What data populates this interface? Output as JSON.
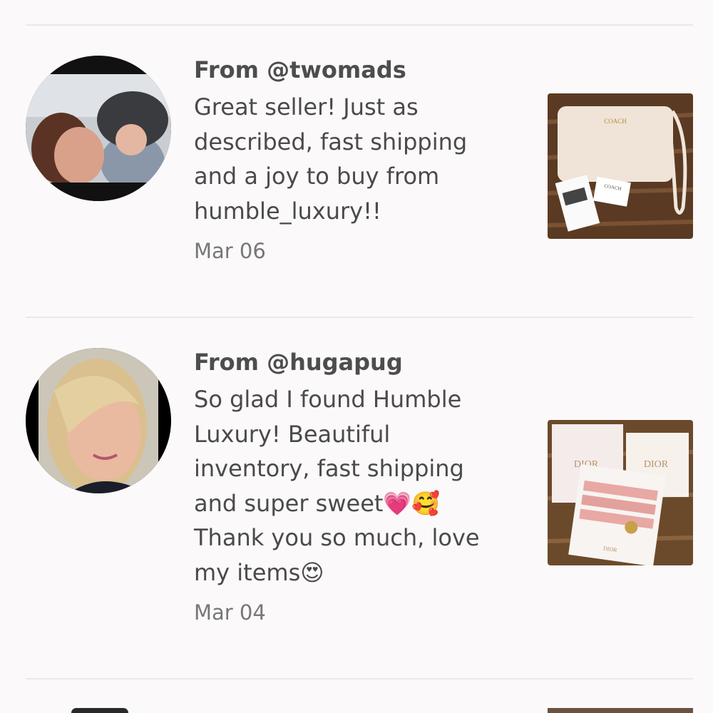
{
  "reviews": [
    {
      "from": "From @twomads",
      "body": "Great seller! Just as\ndescribed, fast shipping\nand a joy to buy from\nhumble_luxury!!",
      "date": "Mar 06",
      "avatar_icon": "user-avatar-photo",
      "thumb_icon": "listing-photo-coach-wristlet",
      "thumb_brand": "COACH"
    },
    {
      "from": "From @hugapug",
      "body": "So glad I found Humble\nLuxury! Beautiful\ninventory, fast shipping\nand super sweet💗🥰\nThank you so much, love\nmy items😍",
      "date": "Mar 04",
      "avatar_icon": "user-avatar-photo",
      "thumb_icon": "listing-photo-dior-hair-ties",
      "thumb_brand_1": "DIOR",
      "thumb_brand_2": "DIOR",
      "thumb_brand_3": "DIOR"
    }
  ],
  "colors": {
    "background": "#fbf9fa",
    "divider": "#eae8e9",
    "text": "#4a4a4a",
    "muted": "#777777"
  }
}
